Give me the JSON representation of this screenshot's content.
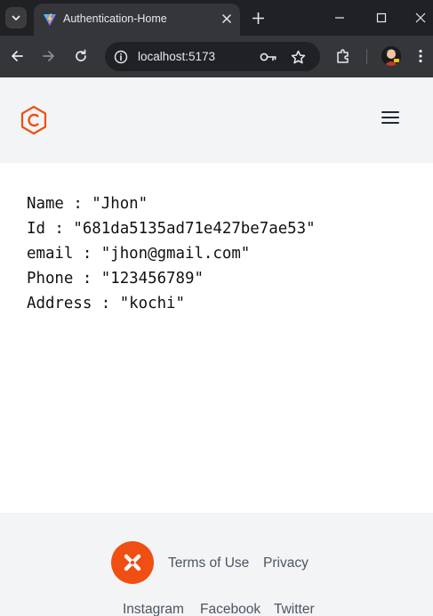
{
  "browser": {
    "tab": {
      "title": "Authentication-Home",
      "favicon": "vite-icon"
    },
    "url": "localhost:5173"
  },
  "profile": {
    "rows": [
      "Name : \"Jhon\"",
      "Id : \"681da5135ad71e427be7ae53\"",
      "email : \"jhon@gmail.com\"",
      "Phone : \"123456789\"",
      "Address : \"kochi\""
    ]
  },
  "footer": {
    "links": {
      "terms": "Terms of Use",
      "privacy": "Privacy",
      "instagram": "Instagram",
      "facebook": "Facebook",
      "twitter": "Twitter"
    }
  },
  "colors": {
    "brand_orange": "#ef4f12",
    "header_bg": "#f3f4f6",
    "chrome_dark": "#202124",
    "chrome_toolbar": "#35363a"
  }
}
